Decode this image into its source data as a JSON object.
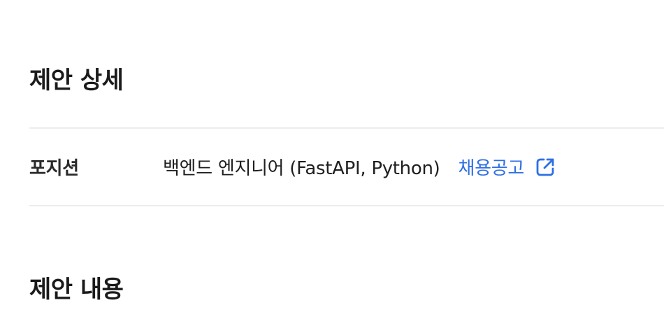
{
  "proposal_detail": {
    "title": "제안 상세",
    "rows": [
      {
        "label": "포지션",
        "value": "백엔드 엔지니어 (FastAPI, Python)",
        "link_label": "채용공고",
        "link_icon": "external-link-icon"
      }
    ]
  },
  "proposal_content": {
    "title": "제안 내용"
  },
  "colors": {
    "link": "#2f6fe4",
    "divider": "#ececec",
    "text": "#1f1f1f"
  }
}
